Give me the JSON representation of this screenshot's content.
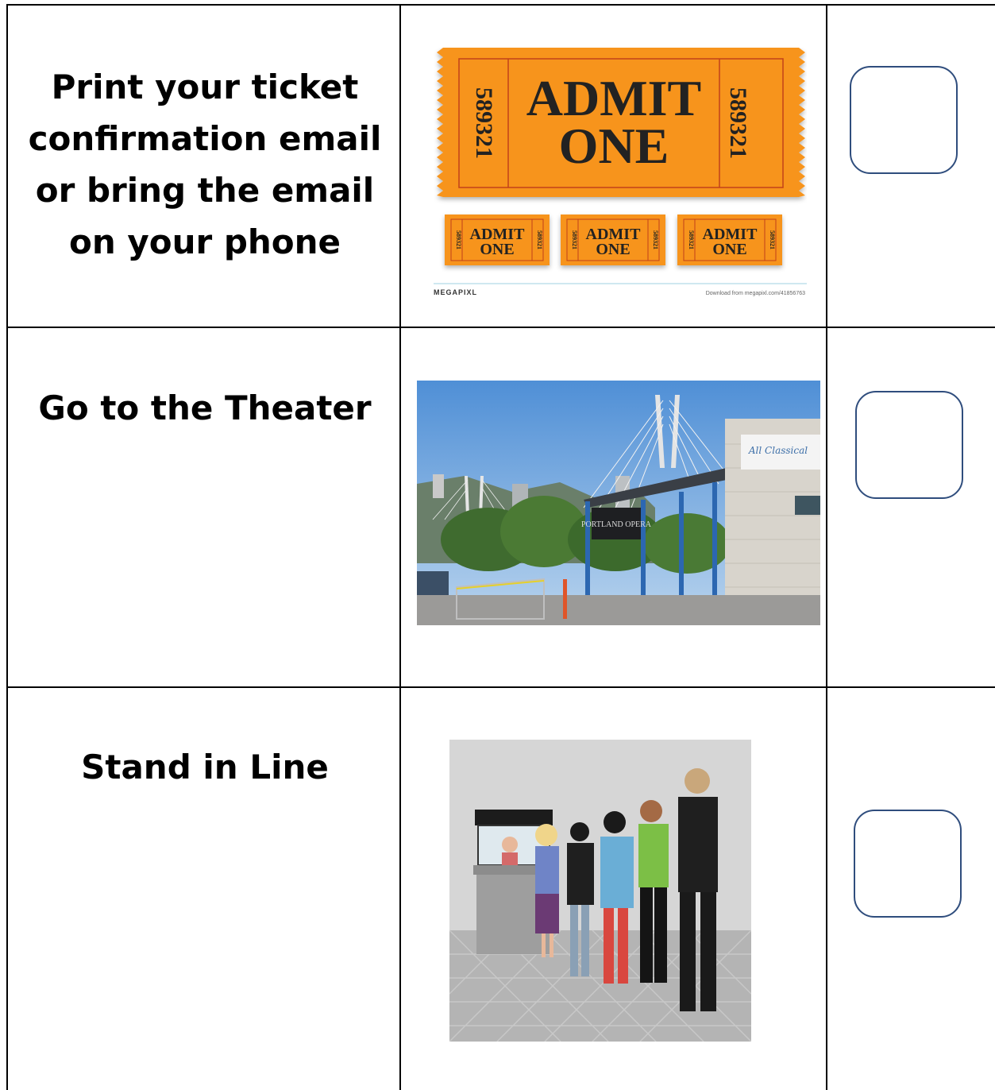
{
  "steps": [
    {
      "text": "Print your ticket confirmation email or bring the email on your phone",
      "image": {
        "big_ticket": {
          "number": "589321",
          "line1": "ADMIT",
          "line2": "ONE"
        },
        "small_ticket": {
          "number": "589321",
          "line1": "ADMIT",
          "line2": "ONE"
        },
        "brand": "MEGAPIXL",
        "download_note": "Download from megapixl.com/41856763"
      }
    },
    {
      "text": "Go to the Theater",
      "image": {
        "sign": "PORTLAND OPERA",
        "building_sign": "All Classical"
      }
    },
    {
      "text": "Stand in Line"
    }
  ],
  "colors": {
    "ticket": "#f7941d",
    "checkbox_border": "#2f4d7d"
  }
}
